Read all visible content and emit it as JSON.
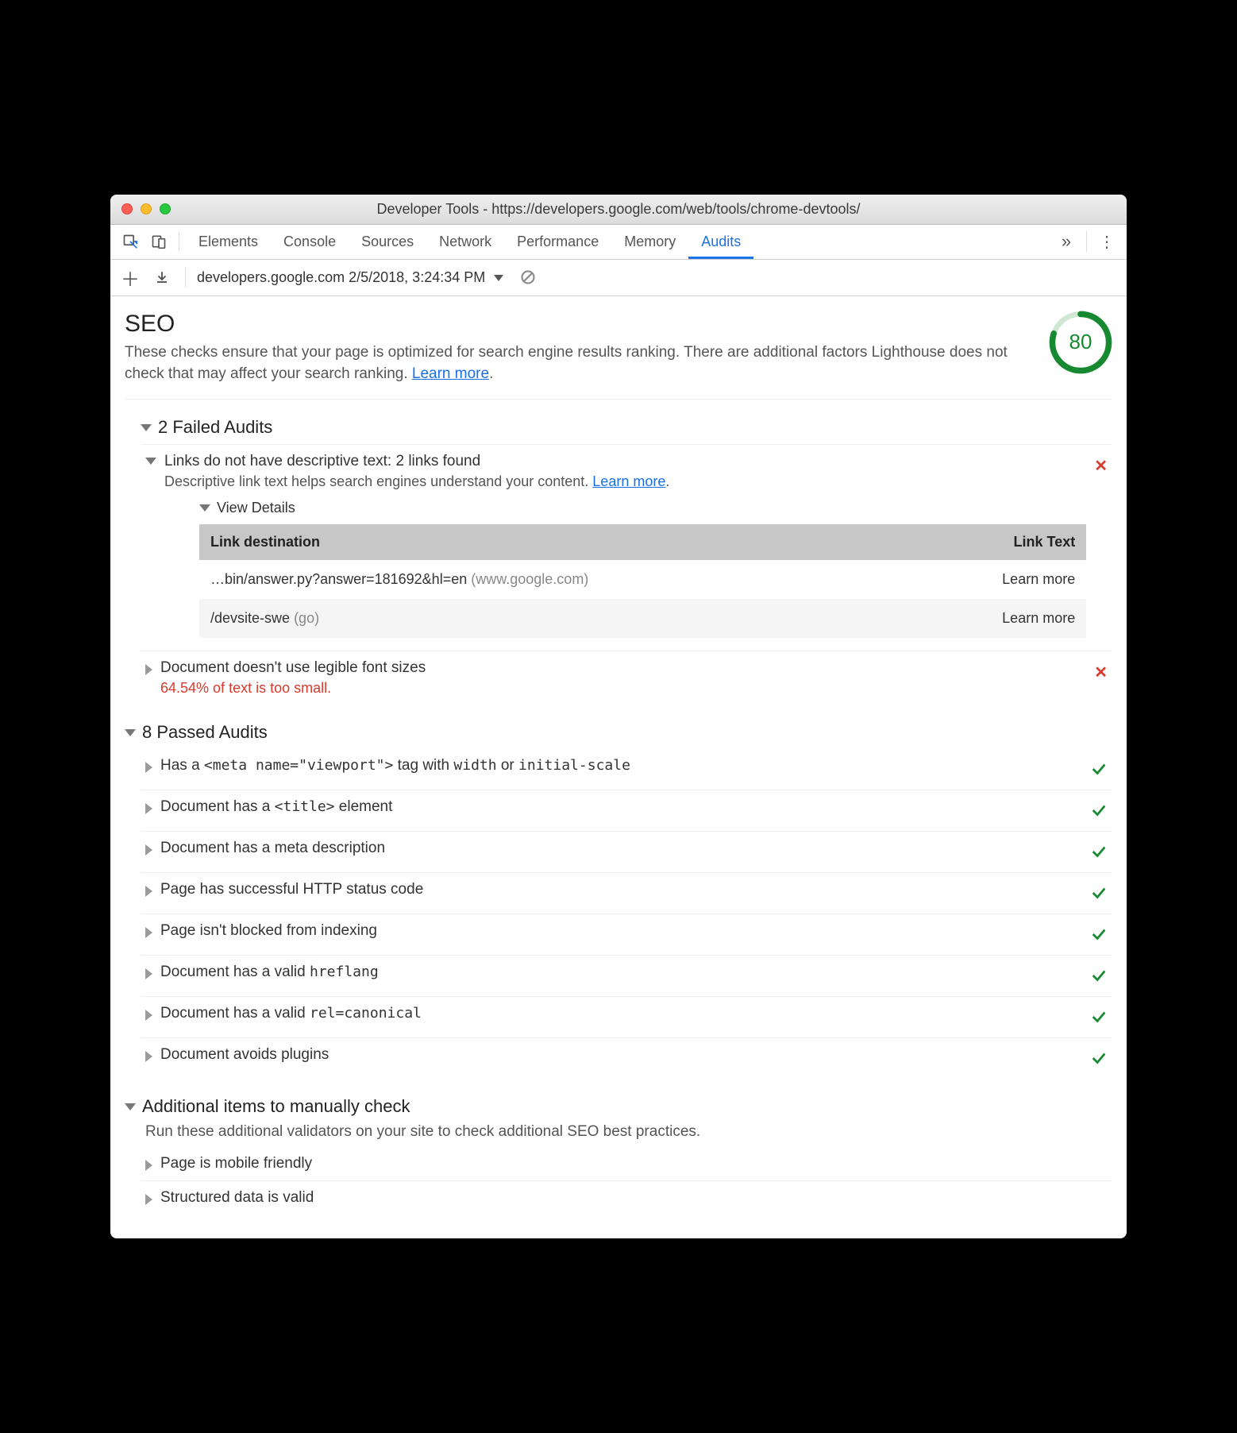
{
  "window": {
    "title": "Developer Tools - https://developers.google.com/web/tools/chrome-devtools/"
  },
  "tabs": [
    "Elements",
    "Console",
    "Sources",
    "Network",
    "Performance",
    "Memory",
    "Audits"
  ],
  "active_tab": "Audits",
  "toolbar": {
    "report_label": "developers.google.com 2/5/2018, 3:24:34 PM"
  },
  "seo": {
    "heading": "SEO",
    "description_a": "These checks ensure that your page is optimized for search engine results ranking. There are additional factors Lighthouse does not check that may affect your search ranking. ",
    "learn_more": "Learn more",
    "score": "80"
  },
  "failed": {
    "title": "2 Failed Audits",
    "items": [
      {
        "title": "Links do not have descriptive text: 2 links found",
        "sub_a": "Descriptive link text helps search engines understand your content. ",
        "learn_more": "Learn more",
        "expanded": true,
        "view_details": "View Details",
        "table": {
          "col1": "Link destination",
          "col2": "Link Text",
          "rows": [
            {
              "dest": "…bin/answer.py?answer=181692&hl=en",
              "host": "(www.google.com)",
              "text": "Learn more"
            },
            {
              "dest": "/devsite-swe",
              "host": "(go)",
              "text": "Learn more"
            }
          ]
        }
      },
      {
        "title": "Document doesn't use legible font sizes",
        "warn": "64.54% of text is too small.",
        "expanded": false
      }
    ]
  },
  "passed": {
    "title": "8 Passed Audits",
    "items": [
      {
        "pre": "Has a ",
        "code": "<meta name=\"viewport\">",
        "mid": " tag with ",
        "code2": "width",
        "mid2": " or ",
        "code3": "initial-scale"
      },
      {
        "pre": "Document has a ",
        "code": "<title>",
        "post": " element"
      },
      {
        "pre": "Document has a meta description"
      },
      {
        "pre": "Page has successful HTTP status code"
      },
      {
        "pre": "Page isn't blocked from indexing"
      },
      {
        "pre": "Document has a valid ",
        "code": "hreflang"
      },
      {
        "pre": "Document has a valid ",
        "code": "rel=canonical"
      },
      {
        "pre": "Document avoids plugins"
      }
    ]
  },
  "manual": {
    "title": "Additional items to manually check",
    "sub": "Run these additional validators on your site to check additional SEO best practices.",
    "items": [
      {
        "title": "Page is mobile friendly"
      },
      {
        "title": "Structured data is valid"
      }
    ]
  }
}
